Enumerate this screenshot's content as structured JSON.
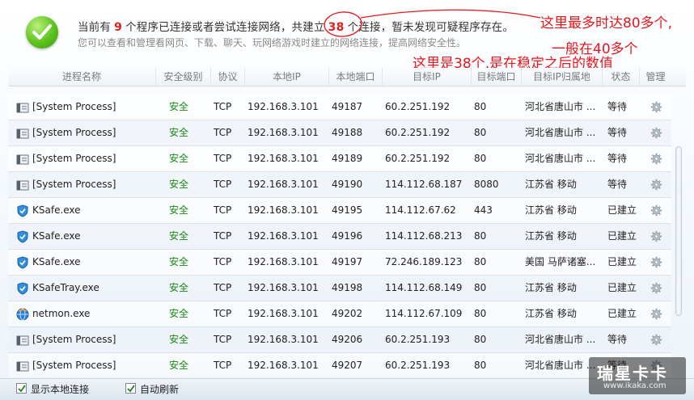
{
  "header": {
    "status_prefix": "当前有",
    "program_count": "9",
    "status_middle": "个程序已连接或者尝试连接网络，共建立",
    "connection_count": "38",
    "status_suffix": "个连接，暂未发现可疑程序存在。",
    "subtext": "您可以查看和管理看网页、下载、聊天、玩网络游戏时建立的网络连接，提高网络安全性。"
  },
  "annotations": {
    "line1": "这里最多时达80多个,",
    "line2": "一般在40多个",
    "line3": "这里是38个,是在稳定之后的数值"
  },
  "columns": [
    "进程名称",
    "安全级别",
    "协议",
    "本地IP",
    "本地端口",
    "目标IP",
    "目标端口",
    "目标IP归属地",
    "状态",
    "管理"
  ],
  "rows": [
    {
      "icon": "system-process-icon",
      "name": "[System Process]",
      "security": "安全",
      "protocol": "TCP",
      "local_ip": "192.168.3.101",
      "local_port": "49187",
      "remote_ip": "60.2.251.192",
      "remote_port": "80",
      "location": "河北省唐山市 ...",
      "status": "等待"
    },
    {
      "icon": "system-process-icon",
      "name": "[System Process]",
      "security": "安全",
      "protocol": "TCP",
      "local_ip": "192.168.3.101",
      "local_port": "49188",
      "remote_ip": "60.2.251.192",
      "remote_port": "80",
      "location": "河北省唐山市 ...",
      "status": "等待"
    },
    {
      "icon": "system-process-icon",
      "name": "[System Process]",
      "security": "安全",
      "protocol": "TCP",
      "local_ip": "192.168.3.101",
      "local_port": "49189",
      "remote_ip": "60.2.251.192",
      "remote_port": "80",
      "location": "河北省唐山市 ...",
      "status": "等待"
    },
    {
      "icon": "system-process-icon",
      "name": "[System Process]",
      "security": "安全",
      "protocol": "TCP",
      "local_ip": "192.168.3.101",
      "local_port": "49190",
      "remote_ip": "114.112.68.187",
      "remote_port": "8080",
      "location": "江苏省 移动",
      "status": "等待"
    },
    {
      "icon": "shield-icon",
      "name": "KSafe.exe",
      "security": "安全",
      "protocol": "TCP",
      "local_ip": "192.168.3.101",
      "local_port": "49195",
      "remote_ip": "114.112.67.62",
      "remote_port": "443",
      "location": "江苏省 移动",
      "status": "已建立"
    },
    {
      "icon": "shield-icon",
      "name": "KSafe.exe",
      "security": "安全",
      "protocol": "TCP",
      "local_ip": "192.168.3.101",
      "local_port": "49196",
      "remote_ip": "114.112.68.213",
      "remote_port": "80",
      "location": "江苏省 移动",
      "status": "已建立"
    },
    {
      "icon": "shield-icon",
      "name": "KSafe.exe",
      "security": "安全",
      "protocol": "TCP",
      "local_ip": "192.168.3.101",
      "local_port": "49197",
      "remote_ip": "72.246.189.123",
      "remote_port": "80",
      "location": "美国 马萨诸塞...",
      "status": "已建立"
    },
    {
      "icon": "shield-icon",
      "name": "KSafeTray.exe",
      "security": "安全",
      "protocol": "TCP",
      "local_ip": "192.168.3.101",
      "local_port": "49198",
      "remote_ip": "114.112.68.149",
      "remote_port": "80",
      "location": "江苏省 移动",
      "status": "已建立"
    },
    {
      "icon": "globe-icon",
      "name": "netmon.exe",
      "security": "安全",
      "protocol": "TCP",
      "local_ip": "192.168.3.101",
      "local_port": "49202",
      "remote_ip": "114.112.67.109",
      "remote_port": "80",
      "location": "江苏省 移动",
      "status": "已建立"
    },
    {
      "icon": "system-process-icon",
      "name": "[System Process]",
      "security": "安全",
      "protocol": "TCP",
      "local_ip": "192.168.3.101",
      "local_port": "49206",
      "remote_ip": "60.2.251.193",
      "remote_port": "80",
      "location": "河北省唐山市 ...",
      "status": "等待"
    },
    {
      "icon": "system-process-icon",
      "name": "[System Process]",
      "security": "安全",
      "protocol": "TCP",
      "local_ip": "192.168.3.101",
      "local_port": "49207",
      "remote_ip": "60.2.251.193",
      "remote_port": "80",
      "location": "河北省唐山市 ...",
      "status": "等待"
    }
  ],
  "footer": {
    "show_local_label": "显示本地连接",
    "auto_refresh_label": "自动刷新"
  },
  "watermark": {
    "title": "瑞星卡卡",
    "url": "www.ikaka.com"
  },
  "colors": {
    "safe_text": "#1a8a12",
    "count_highlight": "#e02020",
    "annotation": "#e8151b"
  }
}
